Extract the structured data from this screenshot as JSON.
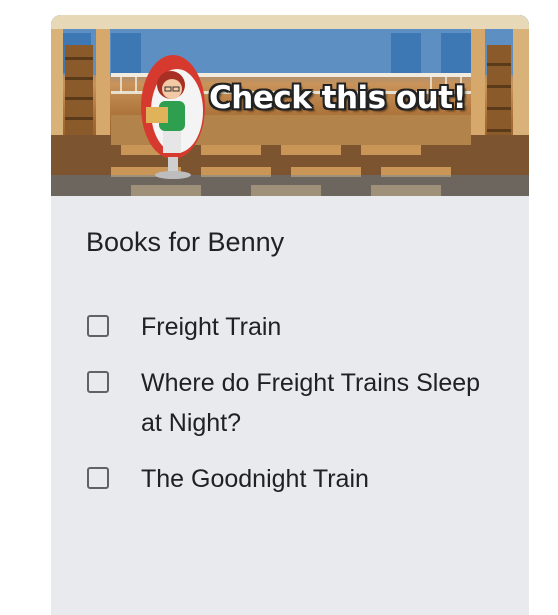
{
  "banner": {
    "text": "Check this out!"
  },
  "list": {
    "title": "Books for Benny",
    "items": [
      {
        "label": "Freight Train",
        "checked": false
      },
      {
        "label": "Where do Freight Trains Sleep at Night?",
        "checked": false
      },
      {
        "label": "The Goodnight Train",
        "checked": false
      }
    ]
  },
  "colors": {
    "card_background": "#e8eaed",
    "text": "#202124",
    "checkbox_border": "#5f6368"
  }
}
